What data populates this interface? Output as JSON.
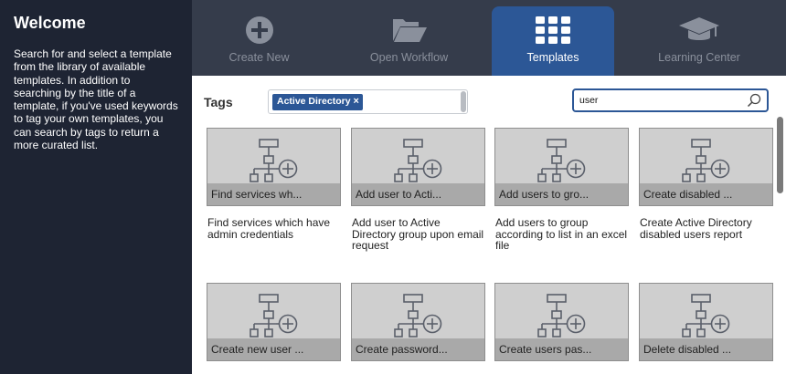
{
  "sidebar": {
    "title": "Welcome",
    "description": "Search for and select a template from the library of available templates. In addition to searching by the title of a template, if you've used keywords to tag your own templates, you can search by tags to return a more curated list."
  },
  "nav": {
    "tabs": [
      {
        "label": "Create New",
        "icon": "plus-circle-icon"
      },
      {
        "label": "Open Workflow",
        "icon": "folder-open-icon"
      },
      {
        "label": "Templates",
        "icon": "grid-icon"
      },
      {
        "label": "Learning Center",
        "icon": "graduation-cap-icon"
      }
    ],
    "active_tab": "Templates"
  },
  "filters": {
    "tags_label": "Tags",
    "selected_tag": "Active Directory",
    "remove_tag_glyph": "×",
    "search_value": "user"
  },
  "colors": {
    "accent": "#2c5796",
    "sidebar_bg": "#1e2433",
    "nav_bg": "#353c4b"
  },
  "templates": [
    {
      "caption": "Find services wh...",
      "description": "Find services which have admin credentials"
    },
    {
      "caption": "Add user to Acti...",
      "description": "Add user to Active Directory group upon email request"
    },
    {
      "caption": "Add users to gro...",
      "description": "Add users to group according to list in an excel file"
    },
    {
      "caption": "Create disabled ...",
      "description": "Create Active Directory disabled users report"
    },
    {
      "caption": "Create new user ...",
      "description": ""
    },
    {
      "caption": "Create password...",
      "description": ""
    },
    {
      "caption": "Create users pas...",
      "description": ""
    },
    {
      "caption": "Delete disabled ...",
      "description": ""
    }
  ]
}
